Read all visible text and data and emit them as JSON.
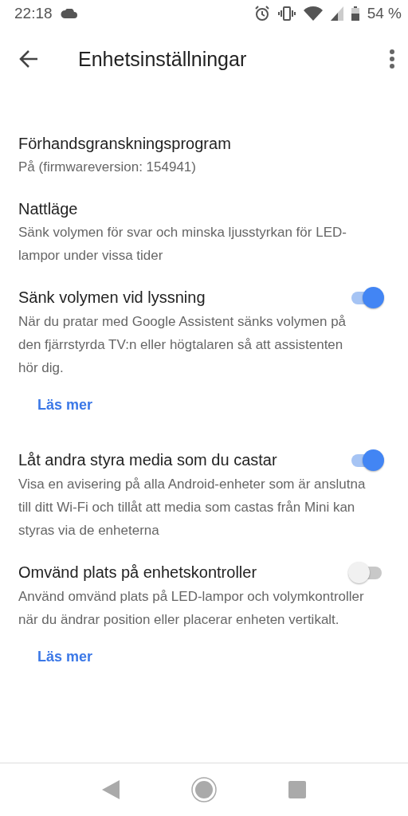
{
  "status_bar": {
    "time": "22:18",
    "battery": "54 %"
  },
  "app_bar": {
    "title": "Enhetsinställningar"
  },
  "settings": [
    {
      "kind": "text",
      "title": "Förhandsgranskningsprogram",
      "description": "På (firmwareversion: 154941)"
    },
    {
      "kind": "text",
      "title": "Nattläge",
      "description": "Sänk volymen för svar och minska ljusstyrkan för LED-lampor under vissa tider"
    },
    {
      "kind": "toggle",
      "title": "Sänk volymen vid lyssning",
      "description": "När du pratar med Google Assistent sänks volymen på den fjärrstyrda TV:n eller högtalaren så att assistenten hör dig.",
      "on": true
    },
    {
      "kind": "link",
      "text": "Läs mer"
    },
    {
      "kind": "toggle",
      "title": "Låt andra styra media som du castar",
      "description": "Visa en avisering på alla Android-enheter som är anslutna till ditt Wi-Fi och tillåt att media som castas från Mini kan styras via de enheterna",
      "on": true
    },
    {
      "kind": "toggle",
      "title": "Omvänd plats på enhetskontroller",
      "description": "Använd omvänd plats på LED-lampor och volymkontroller när du ändrar position eller placerar enheten vertikalt.",
      "on": false
    },
    {
      "kind": "link",
      "text": "Läs mer"
    }
  ]
}
